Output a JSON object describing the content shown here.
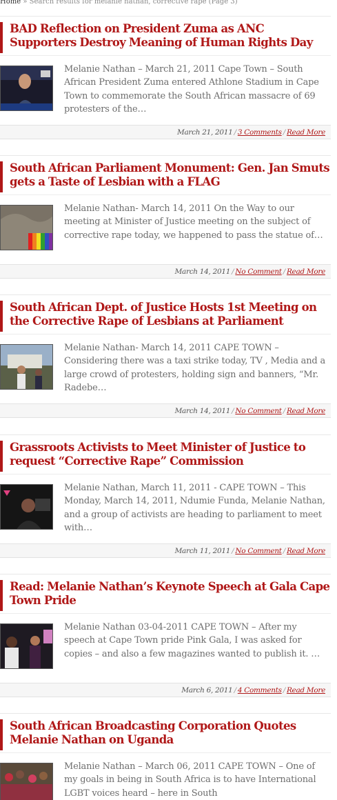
{
  "breadcrumb": {
    "home": "Home",
    "separator": "»",
    "current": "Search results for melanie nathan, corrective rape (Page 3)"
  },
  "posts": [
    {
      "title": "BAD Reflection on President Zuma as ANC Supporters Destroy Meaning of Human Rights Day",
      "excerpt": "Melanie Nathan – March 21, 2011 Cape Town – South African President Zuma entered Athlone Stadium in Cape Town to commemorate the South African massacre of 69 protesters of the…",
      "date": "March 21, 2011",
      "comments": "3 Comments",
      "read_more": "Read More"
    },
    {
      "title": "South African Parliament Monument: Gen. Jan Smuts gets a Taste of Lesbian with a FLAG",
      "excerpt": "Melanie Nathan- March 14, 2011 On the Way to our meeting at Minister of Justice meeting on the subject of corrective rape today, we happened to pass the statue of…",
      "date": "March 14, 2011",
      "comments": "No Comment",
      "read_more": "Read More"
    },
    {
      "title": "South African Dept. of Justice Hosts 1st Meeting on the Corrective Rape of Lesbians at Parliament",
      "excerpt": "Melanie Nathan- March 14, 2011 CAPE TOWN – Considering there was a taxi strike today, TV , Media and a large crowd of protesters, holding sign and banners, “Mr. Radebe…",
      "date": "March 14, 2011",
      "comments": "No Comment",
      "read_more": "Read More"
    },
    {
      "title": "Grassroots Activists to Meet Minister of Justice to request “Corrective Rape” Commission",
      "excerpt": "Melanie Nathan, March 11, 2011 - CAPE TOWN – This Monday, March 14, 2011,  Ndumie Funda, Melanie Nathan, and a group of activists are heading to parliament to meet with…",
      "date": "March 11, 2011",
      "comments": "No Comment",
      "read_more": "Read More"
    },
    {
      "title": "Read: Melanie Nathan’s Keynote Speech at Gala Cape Town Pride",
      "excerpt": "Melanie Nathan 03-04-2011 CAPE TOWN – After my speech at Cape Town pride Pink Gala, I was asked for copies – and also a few magazines wanted to publish it. …",
      "date": "March 6, 2011",
      "comments": "4 Comments",
      "read_more": "Read More"
    },
    {
      "title": "South African Broadcasting Corporation Quotes Melanie Nathan on Uganda",
      "excerpt": "Melanie Nathan – March 06, 2011 CAPE TOWN – One of my goals in being in South Africa is to have International LGBT voices heard – here in South",
      "date": "",
      "comments": "",
      "read_more": ""
    }
  ]
}
